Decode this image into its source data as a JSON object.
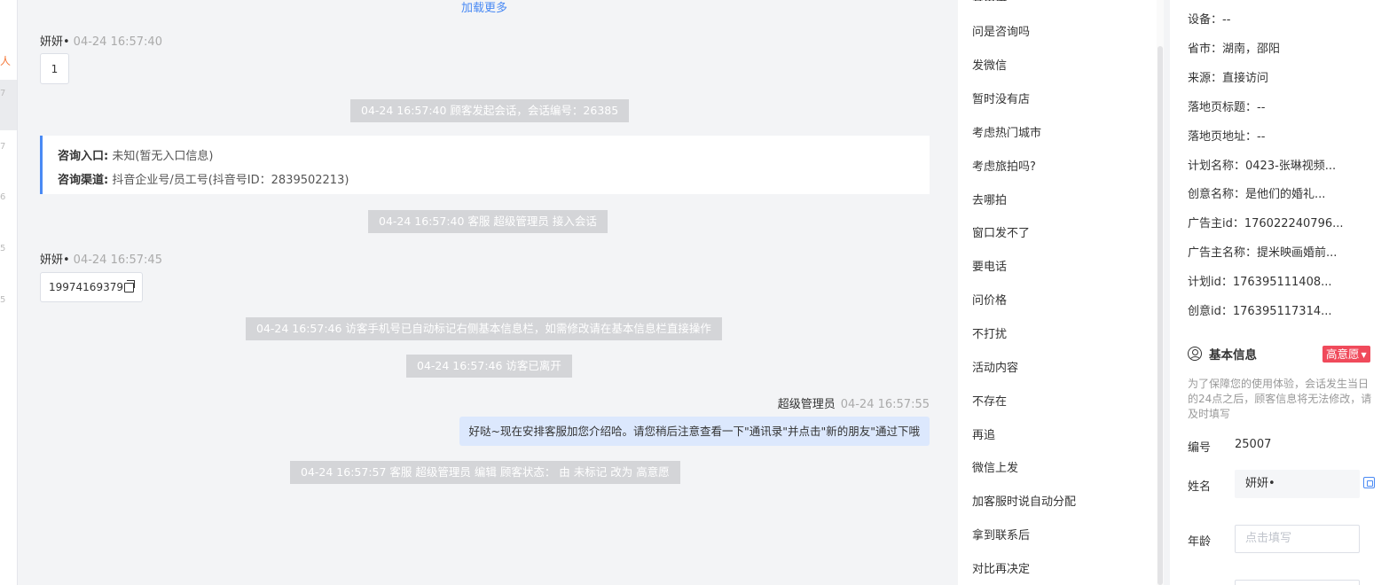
{
  "edge": {
    "marks": [
      "7",
      "7",
      "6",
      "5",
      "5"
    ],
    "active_mark": "人"
  },
  "chat": {
    "load_more": "加载更多",
    "messages": [
      {
        "sender": "妍妍•",
        "time": "04-24 16:57:40",
        "content": "1"
      },
      {
        "sender": "妍妍•",
        "time": "04-24 16:57:45",
        "content": "19974169379"
      }
    ],
    "system": [
      "04-24 16:57:40 顾客发起会话，会话编号：26385",
      "04-24 16:57:40 客服 超级管理员 接入会话",
      "04-24 16:57:46 访客手机号已自动标记右侧基本信息栏，如需修改请在基本信息栏直接操作",
      "04-24 16:57:46 访客已离开",
      "04-24 16:57:57 客服 超级管理员 编辑 顾客状态： 由 未标记 改为 高意愿"
    ],
    "info_card": {
      "entry_label": "咨询入口:",
      "entry_value": "未知(暂无入口信息)",
      "channel_label": "咨询渠道:",
      "channel_value": "抖音企业号/员工号(抖音号ID：2839502213)"
    },
    "agent": {
      "name": "超级管理员",
      "time": "04-24 16:57:55",
      "content": "好哒~现在安排客服加您介绍哈。请您稍后注意查看一下\"通讯录\"并点击\"新的朋友\"通过下哦"
    }
  },
  "quick_replies": {
    "items": [
      "问是咨询吗",
      "发微信",
      "暂时没有店",
      "考虑热门城市",
      "考虑旅拍吗?",
      "去哪拍",
      "窗口发不了",
      "要电话",
      "问价格",
      "不打扰",
      "活动内容",
      "不存在",
      "再追",
      "微信上发",
      "加客服时说自动分配",
      "拿到联系后",
      "对比再决定"
    ]
  },
  "customer": {
    "rows": [
      "设备：--",
      "省市：湖南，邵阳",
      "来源：直接访问",
      "落地页标题：--",
      "落地页地址：--",
      "计划名称：0423-张琳视频...",
      "创意名称：是他们的婚礼...",
      "广告主id：176022240796...",
      "广告主名称：提米映画婚前...",
      "计划id：176395111408...",
      "创意id：176395117314..."
    ],
    "basic_info": {
      "title": "基本信息",
      "intent_badge": "高意愿",
      "note": "为了保障您的使用体验，会话发生当日的24点之后，顾客信息将无法修改，请及时填写",
      "id_label": "编号",
      "id_value": "25007",
      "name_label": "姓名",
      "name_value": "妍妍•",
      "age_label": "年龄",
      "age_placeholder": "点击填写"
    }
  },
  "colors": {
    "accent": "#4a8af4",
    "badge": "#f04a5b",
    "system_bg": "#d4d5d8",
    "agent_bubble": "#dce8fd",
    "chat_bg": "#f3f4f6"
  }
}
